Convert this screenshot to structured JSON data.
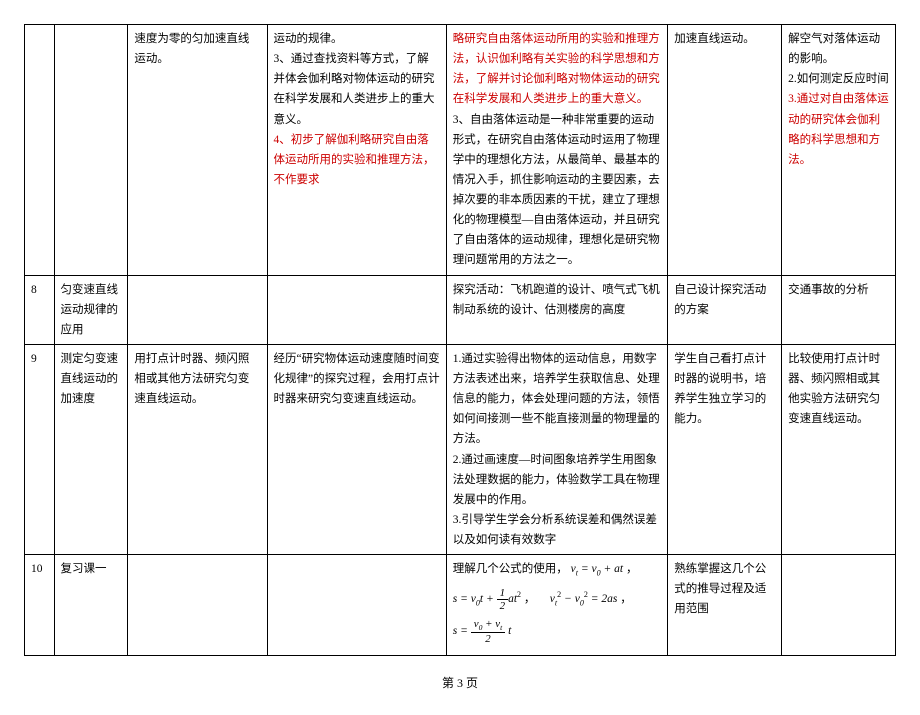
{
  "rows": [
    {
      "idx": "",
      "topic": "",
      "c3": "速度为零的匀加速直线运动。",
      "c4a": "运动的规律。\n3、通过查找资料等方式，了解并体会伽利略对物体运动的研究在科学发展和人类进步上的重大意义。",
      "c4b": "4、初步了解伽利略研究自由落体运动所用的实验和推理方法，不作要求",
      "c5a": "略研究自由落体运动所用的实验和推理方法，认识伽利略有关实验的科学思想和方法，了解并讨论伽利略对物体运动的研究在科学发展和人类进步上的重大意义。",
      "c5b": "3、自由落体运动是一种非常重要的运动形式，在研究自由落体运动时运用了物理学中的理想化方法，从最简单、最基本的情况入手，抓住影响运动的主要因素，去掉次要的非本质因素的干扰，建立了理想化的物理模型—自由落体运动，并且研究了自由落体的运动规律，理想化是研究物理问题常用的方法之一。",
      "c6": "加速直线运动。",
      "c7a": "解空气对落体运动的影响。\n2.如何测定反应时间",
      "c7b": "3.通过对自由落体运动的研究体会伽利略的科学思想和方法。"
    },
    {
      "idx": "8",
      "topic": "匀变速直线运动规律的应用",
      "c3": "",
      "c4": "",
      "c5": "探究活动：飞机跑道的设计、喷气式飞机制动系统的设计、估测楼房的高度",
      "c6": "自己设计探究活动的方案",
      "c7": "交通事故的分析"
    },
    {
      "idx": "9",
      "topic": "测定匀变速直线运动的加速度",
      "c3": "用打点计时器、频闪照相或其他方法研究匀变速直线运动。",
      "c4": "经历“研究物体运动速度随时间变化规律”的探究过程，会用打点计时器来研究匀变速直线运动。",
      "c5": "1.通过实验得出物体的运动信息，用数字方法表述出来，培养学生获取信息、处理信息的能力，体会处理问题的方法，领悟如何间接测一些不能直接测量的物理量的方法。\n2.通过画速度—时间图象培养学生用图象法处理数据的能力，体验数学工具在物理发展中的作用。\n3.引导学生学会分析系统误差和偶然误差以及如何读有效数字",
      "c6": "学生自己看打点计时器的说明书，培养学生独立学习的能力。",
      "c7": "比较使用打点计时器、频闪照相或其他实验方法研究匀变速直线运动。"
    },
    {
      "idx": "10",
      "topic": "复习课一",
      "c3": "",
      "c4": "",
      "c5_intro": "理解几个公式的使用，",
      "c6": "熟练掌握这几个公式的推导过程及适用范围",
      "c7": ""
    }
  ],
  "footer": "第 3 页"
}
